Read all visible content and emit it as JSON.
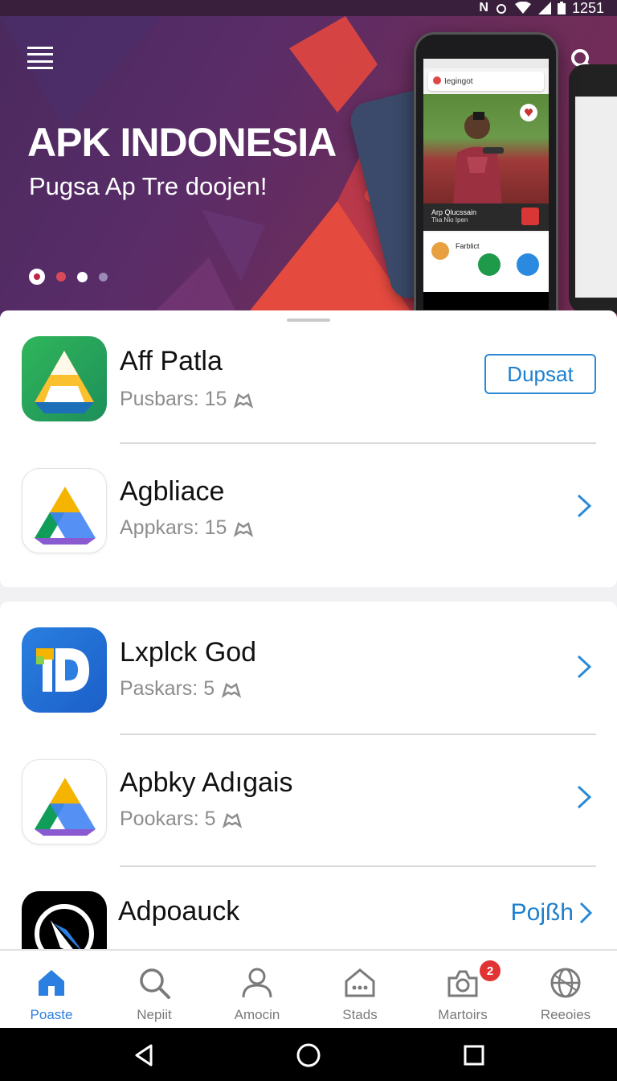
{
  "status_bar": {
    "time": "1251",
    "letter": "N"
  },
  "hero": {
    "title": "APK INDONESIA",
    "subtitle": "Pugsa Ap Tre doojen!",
    "slides_count": 4,
    "active_slide": 1,
    "phone_screen": {
      "search_text": "Iegingot",
      "band_title": "Arp Qlucssain",
      "band_sub": "Tlıa Nio Ipen",
      "card_title": "Farblict"
    }
  },
  "apps": [
    {
      "name": "Aff Patla",
      "meta": "Pusbars: 15",
      "action": "Dupsat",
      "action_type": "button"
    },
    {
      "name": "Agbliace",
      "meta": "Appkars: 15",
      "action_type": "chevron"
    },
    {
      "name": "Lxplck God",
      "meta": "Paskars: 5",
      "action_type": "chevron"
    },
    {
      "name": "Apbky Adıgais",
      "meta": "Pookars: 5",
      "action_type": "chevron"
    },
    {
      "name": "Adpoauck",
      "meta": "",
      "action": "Pojßh",
      "action_type": "link"
    }
  ],
  "bottom_nav": [
    {
      "label": "Poaste",
      "icon": "home-icon",
      "active": true
    },
    {
      "label": "Nepiit",
      "icon": "search-icon"
    },
    {
      "label": "Amocin",
      "icon": "person-icon"
    },
    {
      "label": "Stads",
      "icon": "store-icon"
    },
    {
      "label": "Martoirs",
      "icon": "camera-icon",
      "badge": "2"
    },
    {
      "label": "Reeoies",
      "icon": "globe-icon"
    }
  ],
  "colors": {
    "accent": "#1d7fcf",
    "hero_bg": "#5a2c68",
    "badge": "#e13333"
  }
}
